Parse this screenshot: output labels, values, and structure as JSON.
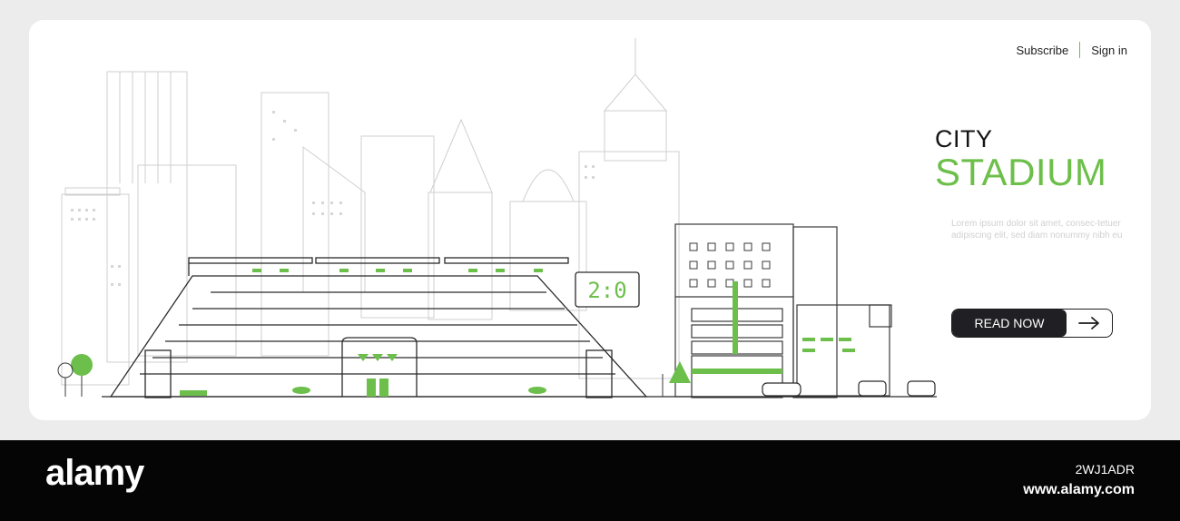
{
  "nav": {
    "subscribe": "Subscribe",
    "signin": "Sign in"
  },
  "hero": {
    "title_line1": "CITY",
    "title_line2": "STADIUM",
    "body": "Lorem ipsum dolor sit amet, consec-tetuer adipiscing elit, sed diam nonummy nibh eu",
    "cta_label": "READ NOW"
  },
  "scoreboard": {
    "score": "2:0"
  },
  "colors": {
    "accent": "#6dbf4b",
    "line": "#c8c8c8",
    "dark": "#1f1f24"
  },
  "icons": {
    "cta": "arrow-right-icon"
  },
  "footer": {
    "brand": "alamy",
    "image_id": "2WJ1ADR",
    "site": "www.alamy.com"
  }
}
